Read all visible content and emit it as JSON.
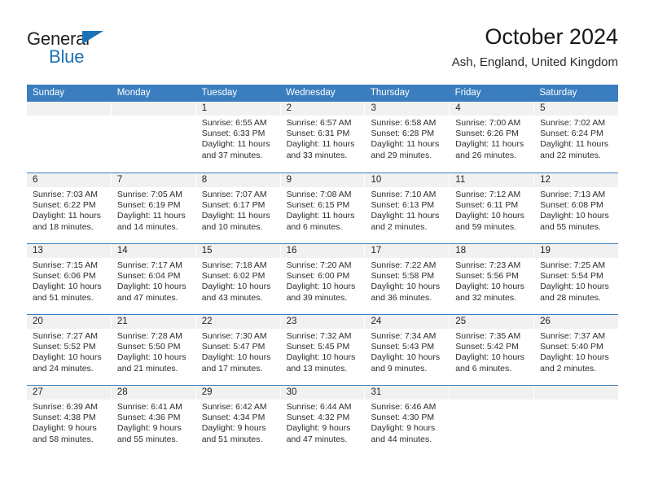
{
  "brand": {
    "name_top": "General",
    "name_bottom": "Blue",
    "accent_color": "#1b72b8"
  },
  "header": {
    "title": "October 2024",
    "subtitle": "Ash, England, United Kingdom"
  },
  "calendar": {
    "header_color": "#3a7ebf",
    "daynumber_band_color": "#f1f1f1",
    "weekdays": [
      "Sunday",
      "Monday",
      "Tuesday",
      "Wednesday",
      "Thursday",
      "Friday",
      "Saturday"
    ],
    "weeks": [
      [
        {
          "day": "",
          "sunrise": "",
          "sunset": "",
          "daylight": ""
        },
        {
          "day": "",
          "sunrise": "",
          "sunset": "",
          "daylight": ""
        },
        {
          "day": "1",
          "sunrise": "Sunrise: 6:55 AM",
          "sunset": "Sunset: 6:33 PM",
          "daylight": "Daylight: 11 hours and 37 minutes."
        },
        {
          "day": "2",
          "sunrise": "Sunrise: 6:57 AM",
          "sunset": "Sunset: 6:31 PM",
          "daylight": "Daylight: 11 hours and 33 minutes."
        },
        {
          "day": "3",
          "sunrise": "Sunrise: 6:58 AM",
          "sunset": "Sunset: 6:28 PM",
          "daylight": "Daylight: 11 hours and 29 minutes."
        },
        {
          "day": "4",
          "sunrise": "Sunrise: 7:00 AM",
          "sunset": "Sunset: 6:26 PM",
          "daylight": "Daylight: 11 hours and 26 minutes."
        },
        {
          "day": "5",
          "sunrise": "Sunrise: 7:02 AM",
          "sunset": "Sunset: 6:24 PM",
          "daylight": "Daylight: 11 hours and 22 minutes."
        }
      ],
      [
        {
          "day": "6",
          "sunrise": "Sunrise: 7:03 AM",
          "sunset": "Sunset: 6:22 PM",
          "daylight": "Daylight: 11 hours and 18 minutes."
        },
        {
          "day": "7",
          "sunrise": "Sunrise: 7:05 AM",
          "sunset": "Sunset: 6:19 PM",
          "daylight": "Daylight: 11 hours and 14 minutes."
        },
        {
          "day": "8",
          "sunrise": "Sunrise: 7:07 AM",
          "sunset": "Sunset: 6:17 PM",
          "daylight": "Daylight: 11 hours and 10 minutes."
        },
        {
          "day": "9",
          "sunrise": "Sunrise: 7:08 AM",
          "sunset": "Sunset: 6:15 PM",
          "daylight": "Daylight: 11 hours and 6 minutes."
        },
        {
          "day": "10",
          "sunrise": "Sunrise: 7:10 AM",
          "sunset": "Sunset: 6:13 PM",
          "daylight": "Daylight: 11 hours and 2 minutes."
        },
        {
          "day": "11",
          "sunrise": "Sunrise: 7:12 AM",
          "sunset": "Sunset: 6:11 PM",
          "daylight": "Daylight: 10 hours and 59 minutes."
        },
        {
          "day": "12",
          "sunrise": "Sunrise: 7:13 AM",
          "sunset": "Sunset: 6:08 PM",
          "daylight": "Daylight: 10 hours and 55 minutes."
        }
      ],
      [
        {
          "day": "13",
          "sunrise": "Sunrise: 7:15 AM",
          "sunset": "Sunset: 6:06 PM",
          "daylight": "Daylight: 10 hours and 51 minutes."
        },
        {
          "day": "14",
          "sunrise": "Sunrise: 7:17 AM",
          "sunset": "Sunset: 6:04 PM",
          "daylight": "Daylight: 10 hours and 47 minutes."
        },
        {
          "day": "15",
          "sunrise": "Sunrise: 7:18 AM",
          "sunset": "Sunset: 6:02 PM",
          "daylight": "Daylight: 10 hours and 43 minutes."
        },
        {
          "day": "16",
          "sunrise": "Sunrise: 7:20 AM",
          "sunset": "Sunset: 6:00 PM",
          "daylight": "Daylight: 10 hours and 39 minutes."
        },
        {
          "day": "17",
          "sunrise": "Sunrise: 7:22 AM",
          "sunset": "Sunset: 5:58 PM",
          "daylight": "Daylight: 10 hours and 36 minutes."
        },
        {
          "day": "18",
          "sunrise": "Sunrise: 7:23 AM",
          "sunset": "Sunset: 5:56 PM",
          "daylight": "Daylight: 10 hours and 32 minutes."
        },
        {
          "day": "19",
          "sunrise": "Sunrise: 7:25 AM",
          "sunset": "Sunset: 5:54 PM",
          "daylight": "Daylight: 10 hours and 28 minutes."
        }
      ],
      [
        {
          "day": "20",
          "sunrise": "Sunrise: 7:27 AM",
          "sunset": "Sunset: 5:52 PM",
          "daylight": "Daylight: 10 hours and 24 minutes."
        },
        {
          "day": "21",
          "sunrise": "Sunrise: 7:28 AM",
          "sunset": "Sunset: 5:50 PM",
          "daylight": "Daylight: 10 hours and 21 minutes."
        },
        {
          "day": "22",
          "sunrise": "Sunrise: 7:30 AM",
          "sunset": "Sunset: 5:47 PM",
          "daylight": "Daylight: 10 hours and 17 minutes."
        },
        {
          "day": "23",
          "sunrise": "Sunrise: 7:32 AM",
          "sunset": "Sunset: 5:45 PM",
          "daylight": "Daylight: 10 hours and 13 minutes."
        },
        {
          "day": "24",
          "sunrise": "Sunrise: 7:34 AM",
          "sunset": "Sunset: 5:43 PM",
          "daylight": "Daylight: 10 hours and 9 minutes."
        },
        {
          "day": "25",
          "sunrise": "Sunrise: 7:35 AM",
          "sunset": "Sunset: 5:42 PM",
          "daylight": "Daylight: 10 hours and 6 minutes."
        },
        {
          "day": "26",
          "sunrise": "Sunrise: 7:37 AM",
          "sunset": "Sunset: 5:40 PM",
          "daylight": "Daylight: 10 hours and 2 minutes."
        }
      ],
      [
        {
          "day": "27",
          "sunrise": "Sunrise: 6:39 AM",
          "sunset": "Sunset: 4:38 PM",
          "daylight": "Daylight: 9 hours and 58 minutes."
        },
        {
          "day": "28",
          "sunrise": "Sunrise: 6:41 AM",
          "sunset": "Sunset: 4:36 PM",
          "daylight": "Daylight: 9 hours and 55 minutes."
        },
        {
          "day": "29",
          "sunrise": "Sunrise: 6:42 AM",
          "sunset": "Sunset: 4:34 PM",
          "daylight": "Daylight: 9 hours and 51 minutes."
        },
        {
          "day": "30",
          "sunrise": "Sunrise: 6:44 AM",
          "sunset": "Sunset: 4:32 PM",
          "daylight": "Daylight: 9 hours and 47 minutes."
        },
        {
          "day": "31",
          "sunrise": "Sunrise: 6:46 AM",
          "sunset": "Sunset: 4:30 PM",
          "daylight": "Daylight: 9 hours and 44 minutes."
        },
        {
          "day": "",
          "sunrise": "",
          "sunset": "",
          "daylight": ""
        },
        {
          "day": "",
          "sunrise": "",
          "sunset": "",
          "daylight": ""
        }
      ]
    ]
  }
}
